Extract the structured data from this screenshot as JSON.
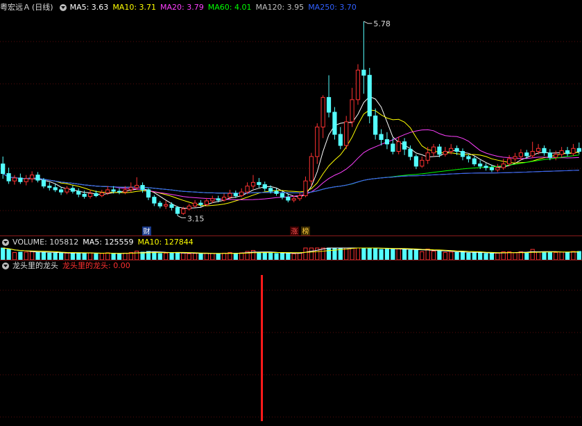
{
  "header": {
    "stock_name": "粤宏远Ａ",
    "period": "(日线)",
    "ma": [
      {
        "label": "MA5: 3.63",
        "color": "#ffffff"
      },
      {
        "label": "MA10: 3.71",
        "color": "#ffff00"
      },
      {
        "label": "MA20: 3.79",
        "color": "#ff40ff"
      },
      {
        "label": "MA60: 4.01",
        "color": "#00ff00"
      },
      {
        "label": "MA120: 3.95",
        "color": "#c0c0c0"
      },
      {
        "label": "MA250: 3.70",
        "color": "#3060ff"
      }
    ]
  },
  "volume_header": {
    "label": "VOLUME: 105812",
    "ma5": "MA5: 125559",
    "ma10": "MA10: 127844"
  },
  "indicator_header": {
    "name": "龙头里的龙头",
    "value": "龙头里的龙头: 0.00"
  },
  "annotations": {
    "high": "5.78",
    "low": "3.15",
    "tag_cai": "财",
    "tag_zhang": "涨",
    "tag_bang": "榜"
  },
  "chart_data": {
    "type": "candlestick",
    "price_range": [
      3.05,
      5.9
    ],
    "bars": [
      [
        3.85,
        3.72,
        3.95,
        3.65
      ],
      [
        3.72,
        3.62,
        3.8,
        3.58
      ],
      [
        3.62,
        3.66,
        3.7,
        3.57
      ],
      [
        3.66,
        3.61,
        3.72,
        3.58
      ],
      [
        3.61,
        3.65,
        3.7,
        3.56
      ],
      [
        3.65,
        3.7,
        3.75,
        3.6
      ],
      [
        3.7,
        3.63,
        3.74,
        3.6
      ],
      [
        3.63,
        3.55,
        3.66,
        3.52
      ],
      [
        3.55,
        3.53,
        3.6,
        3.49
      ],
      [
        3.53,
        3.5,
        3.58,
        3.47
      ],
      [
        3.5,
        3.47,
        3.54,
        3.43
      ],
      [
        3.47,
        3.52,
        3.55,
        3.44
      ],
      [
        3.52,
        3.48,
        3.56,
        3.45
      ],
      [
        3.48,
        3.44,
        3.52,
        3.4
      ],
      [
        3.44,
        3.41,
        3.49,
        3.38
      ],
      [
        3.41,
        3.45,
        3.5,
        3.38
      ],
      [
        3.45,
        3.42,
        3.49,
        3.4
      ],
      [
        3.42,
        3.46,
        3.5,
        3.4
      ],
      [
        3.46,
        3.5,
        3.55,
        3.43
      ],
      [
        3.5,
        3.48,
        3.55,
        3.45
      ],
      [
        3.48,
        3.47,
        3.52,
        3.44
      ],
      [
        3.47,
        3.5,
        3.55,
        3.44
      ],
      [
        3.5,
        3.53,
        3.6,
        3.47
      ],
      [
        3.53,
        3.56,
        3.67,
        3.5
      ],
      [
        3.56,
        3.5,
        3.6,
        3.46
      ],
      [
        3.5,
        3.4,
        3.52,
        3.36
      ],
      [
        3.4,
        3.32,
        3.43,
        3.28
      ],
      [
        3.32,
        3.28,
        3.35,
        3.25
      ],
      [
        3.28,
        3.3,
        3.35,
        3.24
      ],
      [
        3.3,
        3.26,
        3.33,
        3.22
      ],
      [
        3.26,
        3.18,
        3.28,
        3.15
      ],
      [
        3.18,
        3.24,
        3.27,
        3.16
      ],
      [
        3.24,
        3.28,
        3.31,
        3.22
      ],
      [
        3.28,
        3.32,
        3.36,
        3.26
      ],
      [
        3.32,
        3.3,
        3.36,
        3.27
      ],
      [
        3.3,
        3.35,
        3.39,
        3.28
      ],
      [
        3.35,
        3.38,
        3.42,
        3.32
      ],
      [
        3.38,
        3.36,
        3.42,
        3.33
      ],
      [
        3.36,
        3.4,
        3.45,
        3.34
      ],
      [
        3.4,
        3.45,
        3.5,
        3.37
      ],
      [
        3.45,
        3.42,
        3.49,
        3.39
      ],
      [
        3.42,
        3.47,
        3.52,
        3.4
      ],
      [
        3.47,
        3.55,
        3.6,
        3.44
      ],
      [
        3.55,
        3.6,
        3.7,
        3.51
      ],
      [
        3.6,
        3.57,
        3.66,
        3.53
      ],
      [
        3.57,
        3.52,
        3.61,
        3.48
      ],
      [
        3.52,
        3.48,
        3.56,
        3.45
      ],
      [
        3.48,
        3.45,
        3.52,
        3.42
      ],
      [
        3.45,
        3.4,
        3.48,
        3.37
      ],
      [
        3.4,
        3.36,
        3.44,
        3.33
      ],
      [
        3.36,
        3.38,
        3.42,
        3.33
      ],
      [
        3.38,
        3.42,
        3.46,
        3.35
      ],
      [
        3.42,
        3.62,
        3.68,
        3.4
      ],
      [
        3.62,
        3.95,
        4.0,
        3.55
      ],
      [
        3.95,
        4.35,
        4.4,
        3.85
      ],
      [
        4.35,
        4.75,
        4.78,
        4.2
      ],
      [
        4.75,
        4.55,
        5.05,
        4.48
      ],
      [
        4.55,
        4.25,
        4.62,
        4.18
      ],
      [
        4.25,
        4.1,
        4.35,
        4.05
      ],
      [
        4.1,
        4.42,
        4.5,
        4.05
      ],
      [
        4.42,
        4.72,
        4.88,
        4.35
      ],
      [
        4.72,
        5.12,
        5.2,
        4.65
      ],
      [
        5.12,
        5.05,
        5.78,
        4.8
      ],
      [
        5.05,
        4.5,
        5.15,
        4.4
      ],
      [
        4.5,
        4.25,
        4.6,
        4.18
      ],
      [
        4.25,
        4.18,
        4.32,
        4.1
      ],
      [
        4.18,
        4.12,
        4.28,
        4.05
      ],
      [
        4.12,
        4.02,
        4.2,
        3.98
      ],
      [
        4.02,
        4.15,
        4.22,
        3.98
      ],
      [
        4.15,
        4.05,
        4.2,
        3.97
      ],
      [
        4.05,
        3.95,
        4.1,
        3.9
      ],
      [
        3.95,
        3.82,
        3.98,
        3.78
      ],
      [
        3.82,
        3.9,
        3.95,
        3.8
      ],
      [
        3.9,
        4.0,
        4.08,
        3.85
      ],
      [
        4.0,
        4.08,
        4.12,
        3.95
      ],
      [
        4.08,
        3.98,
        4.12,
        3.94
      ],
      [
        3.98,
        4.02,
        4.08,
        3.95
      ],
      [
        4.02,
        4.06,
        4.12,
        3.98
      ],
      [
        4.06,
        4.02,
        4.1,
        3.97
      ],
      [
        4.02,
        3.95,
        4.06,
        3.9
      ],
      [
        3.95,
        3.92,
        3.98,
        3.87
      ],
      [
        3.92,
        3.85,
        3.95,
        3.82
      ],
      [
        3.85,
        3.82,
        3.9,
        3.78
      ],
      [
        3.82,
        3.8,
        3.86,
        3.76
      ],
      [
        3.8,
        3.77,
        3.84,
        3.74
      ],
      [
        3.77,
        3.8,
        3.85,
        3.74
      ],
      [
        3.8,
        3.85,
        3.92,
        3.77
      ],
      [
        3.85,
        3.92,
        3.97,
        3.82
      ],
      [
        3.92,
        3.95,
        4.0,
        3.88
      ],
      [
        3.95,
        4.0,
        4.05,
        3.9
      ],
      [
        4.0,
        3.96,
        4.04,
        3.92
      ],
      [
        3.96,
        4.02,
        4.15,
        3.93
      ],
      [
        4.02,
        4.06,
        4.12,
        3.98
      ],
      [
        4.06,
        4.0,
        4.1,
        3.96
      ],
      [
        4.0,
        3.94,
        4.05,
        3.9
      ],
      [
        3.94,
        3.98,
        4.03,
        3.9
      ],
      [
        3.98,
        4.03,
        4.08,
        3.94
      ],
      [
        4.03,
        3.99,
        4.08,
        3.95
      ],
      [
        3.99,
        4.06,
        4.12,
        3.96
      ],
      [
        4.06,
        4.02,
        4.14,
        3.98
      ]
    ]
  }
}
